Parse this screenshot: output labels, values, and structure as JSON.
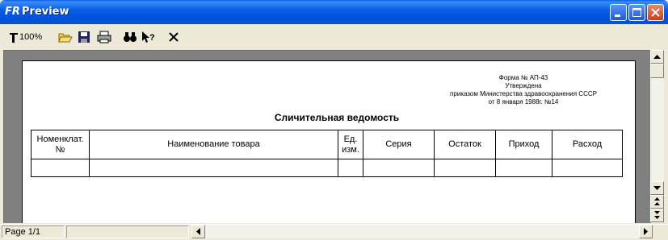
{
  "window": {
    "title": "Preview"
  },
  "toolbar": {
    "zoom_label": "100%",
    "icons": [
      "zoom-icon",
      "open-folder-icon",
      "save-icon",
      "print-icon",
      "find-icon",
      "help-pointer-icon",
      "close-icon"
    ]
  },
  "document": {
    "header_lines": [
      "Форма № АП-43",
      "Утверждена",
      "приказом Министерства здравоохранения СССР",
      "от 8 января 1988г. №14"
    ],
    "title": "Сличительная ведомость",
    "columns": [
      "Номенклат. №",
      "Наименование товара",
      "Ед. изм.",
      "Серия",
      "Остаток",
      "Приход",
      "Расход"
    ]
  },
  "status": {
    "page_text": "Page 1/1"
  },
  "colors": {
    "titlebar": "#0053e0",
    "chrome": "#ece9d8",
    "workspace": "#808080"
  }
}
